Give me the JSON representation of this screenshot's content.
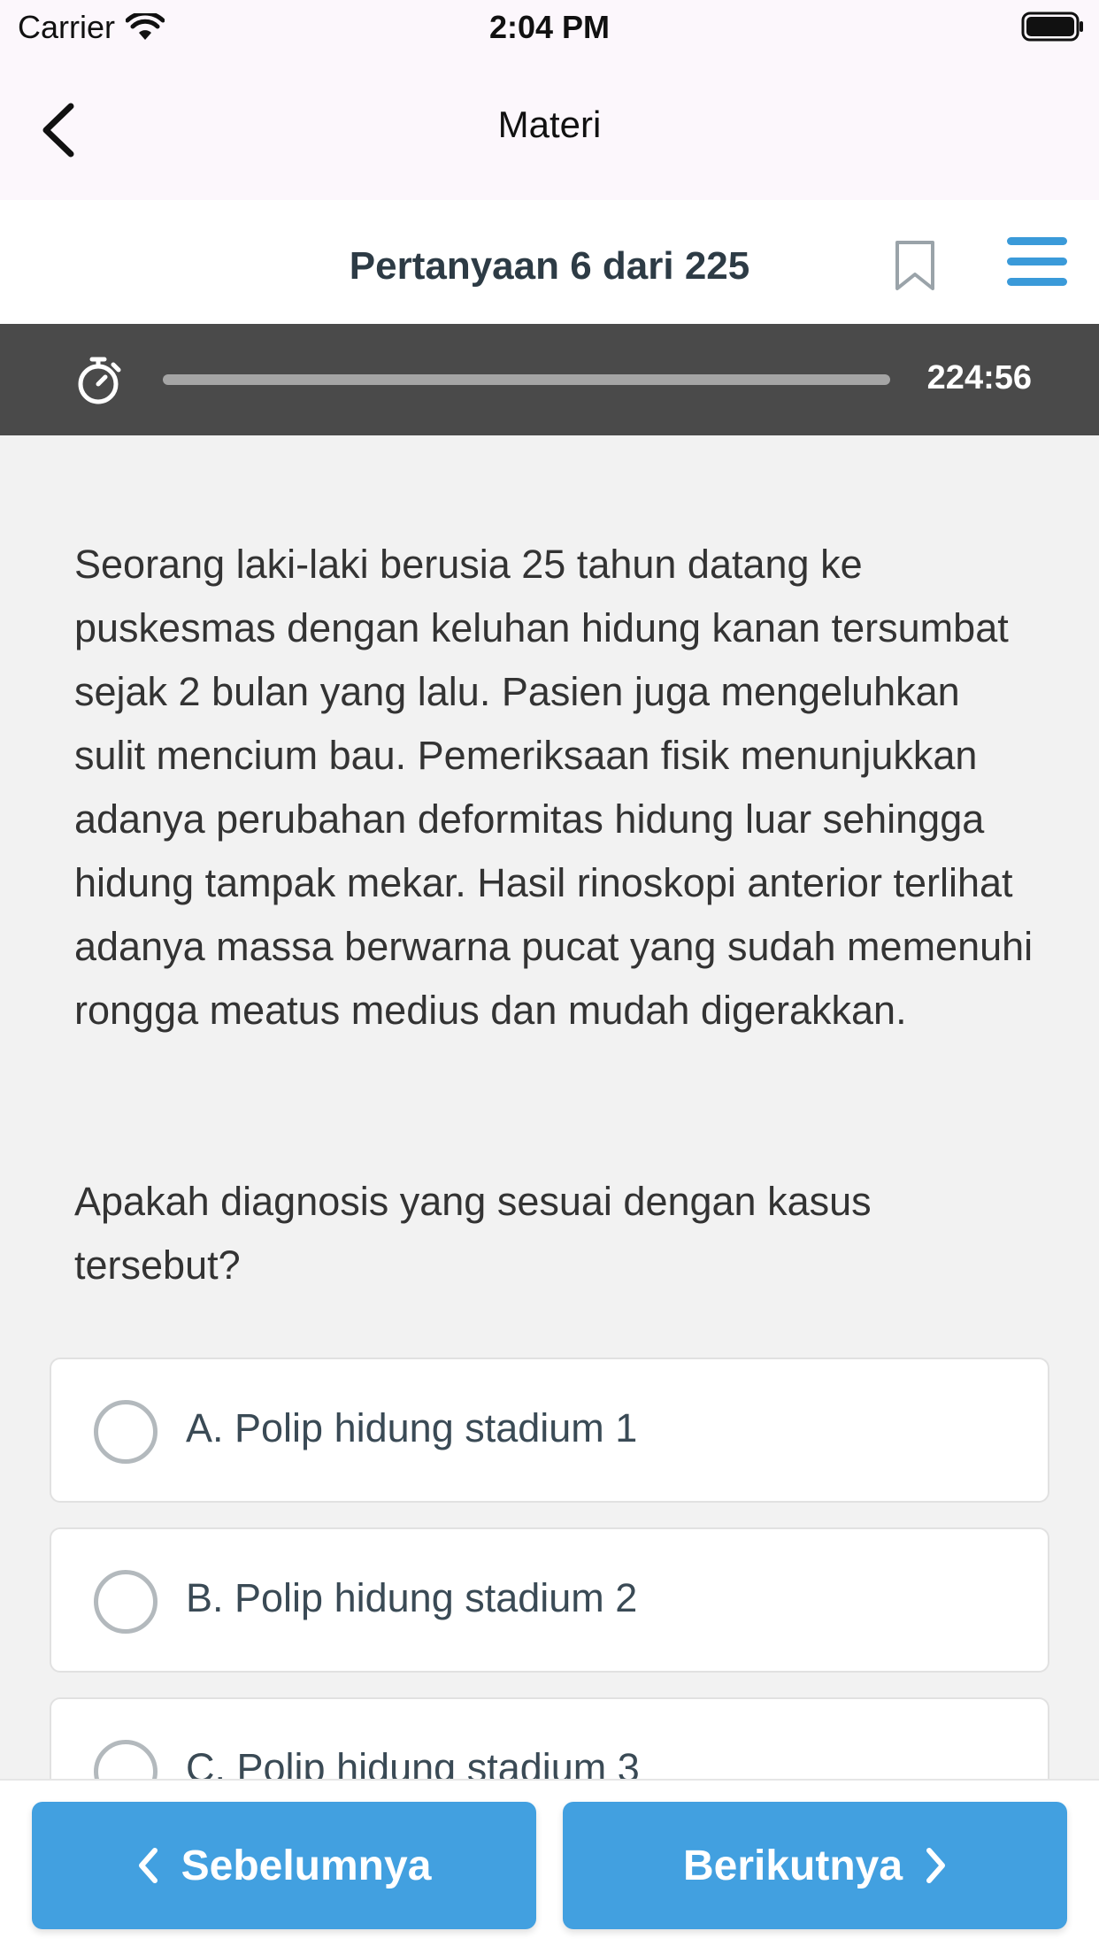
{
  "status_bar": {
    "carrier": "Carrier",
    "time": "2:04 PM"
  },
  "nav": {
    "title": "Materi"
  },
  "question_header": {
    "counter": "Pertanyaan 6 dari 225"
  },
  "timer": {
    "remaining": "224:56",
    "progress_fraction": 1.0
  },
  "question": {
    "text": "Seorang laki-laki berusia 25 tahun datang ke puskesmas dengan keluhan hidung kanan tersumbat sejak 2 bulan yang lalu. Pasien juga mengeluhkan sulit mencium bau. Pemeriksaan fisik menunjukkan adanya perubahan deformitas hidung luar sehingga hidung tampak mekar. Hasil rinoskopi anterior terlihat adanya massa berwarna pucat yang sudah memenuhi rongga meatus medius dan mudah digerakkan.",
    "prompt": "Apakah diagnosis yang sesuai dengan kasus tersebut?",
    "options": [
      {
        "label": "A. Polip hidung stadium 1"
      },
      {
        "label": "B. Polip hidung stadium 2"
      },
      {
        "label": "C. Polip hidung stadium 3"
      }
    ]
  },
  "footer": {
    "prev_label": "Sebelumnya",
    "next_label": "Berikutnya"
  },
  "colors": {
    "accent": "#42a0e0",
    "timer_bar": "#4a4a4a",
    "menu_icon": "#3a9ad9"
  },
  "icons": [
    "wifi-icon",
    "battery-icon",
    "back-chevron-icon",
    "bookmark-icon",
    "menu-icon",
    "stopwatch-icon",
    "chevron-left-icon",
    "chevron-right-icon"
  ]
}
